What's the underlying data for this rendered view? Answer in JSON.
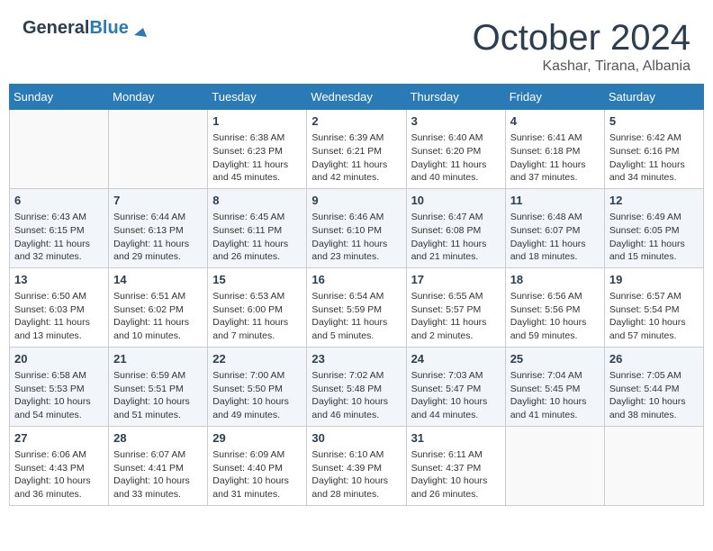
{
  "header": {
    "logo_general": "General",
    "logo_blue": "Blue",
    "month": "October 2024",
    "location": "Kashar, Tirana, Albania"
  },
  "weekdays": [
    "Sunday",
    "Monday",
    "Tuesday",
    "Wednesday",
    "Thursday",
    "Friday",
    "Saturday"
  ],
  "weeks": [
    [
      {
        "day": null
      },
      {
        "day": null
      },
      {
        "day": "1",
        "sunrise": "Sunrise: 6:38 AM",
        "sunset": "Sunset: 6:23 PM",
        "daylight": "Daylight: 11 hours and 45 minutes."
      },
      {
        "day": "2",
        "sunrise": "Sunrise: 6:39 AM",
        "sunset": "Sunset: 6:21 PM",
        "daylight": "Daylight: 11 hours and 42 minutes."
      },
      {
        "day": "3",
        "sunrise": "Sunrise: 6:40 AM",
        "sunset": "Sunset: 6:20 PM",
        "daylight": "Daylight: 11 hours and 40 minutes."
      },
      {
        "day": "4",
        "sunrise": "Sunrise: 6:41 AM",
        "sunset": "Sunset: 6:18 PM",
        "daylight": "Daylight: 11 hours and 37 minutes."
      },
      {
        "day": "5",
        "sunrise": "Sunrise: 6:42 AM",
        "sunset": "Sunset: 6:16 PM",
        "daylight": "Daylight: 11 hours and 34 minutes."
      }
    ],
    [
      {
        "day": "6",
        "sunrise": "Sunrise: 6:43 AM",
        "sunset": "Sunset: 6:15 PM",
        "daylight": "Daylight: 11 hours and 32 minutes."
      },
      {
        "day": "7",
        "sunrise": "Sunrise: 6:44 AM",
        "sunset": "Sunset: 6:13 PM",
        "daylight": "Daylight: 11 hours and 29 minutes."
      },
      {
        "day": "8",
        "sunrise": "Sunrise: 6:45 AM",
        "sunset": "Sunset: 6:11 PM",
        "daylight": "Daylight: 11 hours and 26 minutes."
      },
      {
        "day": "9",
        "sunrise": "Sunrise: 6:46 AM",
        "sunset": "Sunset: 6:10 PM",
        "daylight": "Daylight: 11 hours and 23 minutes."
      },
      {
        "day": "10",
        "sunrise": "Sunrise: 6:47 AM",
        "sunset": "Sunset: 6:08 PM",
        "daylight": "Daylight: 11 hours and 21 minutes."
      },
      {
        "day": "11",
        "sunrise": "Sunrise: 6:48 AM",
        "sunset": "Sunset: 6:07 PM",
        "daylight": "Daylight: 11 hours and 18 minutes."
      },
      {
        "day": "12",
        "sunrise": "Sunrise: 6:49 AM",
        "sunset": "Sunset: 6:05 PM",
        "daylight": "Daylight: 11 hours and 15 minutes."
      }
    ],
    [
      {
        "day": "13",
        "sunrise": "Sunrise: 6:50 AM",
        "sunset": "Sunset: 6:03 PM",
        "daylight": "Daylight: 11 hours and 13 minutes."
      },
      {
        "day": "14",
        "sunrise": "Sunrise: 6:51 AM",
        "sunset": "Sunset: 6:02 PM",
        "daylight": "Daylight: 11 hours and 10 minutes."
      },
      {
        "day": "15",
        "sunrise": "Sunrise: 6:53 AM",
        "sunset": "Sunset: 6:00 PM",
        "daylight": "Daylight: 11 hours and 7 minutes."
      },
      {
        "day": "16",
        "sunrise": "Sunrise: 6:54 AM",
        "sunset": "Sunset: 5:59 PM",
        "daylight": "Daylight: 11 hours and 5 minutes."
      },
      {
        "day": "17",
        "sunrise": "Sunrise: 6:55 AM",
        "sunset": "Sunset: 5:57 PM",
        "daylight": "Daylight: 11 hours and 2 minutes."
      },
      {
        "day": "18",
        "sunrise": "Sunrise: 6:56 AM",
        "sunset": "Sunset: 5:56 PM",
        "daylight": "Daylight: 10 hours and 59 minutes."
      },
      {
        "day": "19",
        "sunrise": "Sunrise: 6:57 AM",
        "sunset": "Sunset: 5:54 PM",
        "daylight": "Daylight: 10 hours and 57 minutes."
      }
    ],
    [
      {
        "day": "20",
        "sunrise": "Sunrise: 6:58 AM",
        "sunset": "Sunset: 5:53 PM",
        "daylight": "Daylight: 10 hours and 54 minutes."
      },
      {
        "day": "21",
        "sunrise": "Sunrise: 6:59 AM",
        "sunset": "Sunset: 5:51 PM",
        "daylight": "Daylight: 10 hours and 51 minutes."
      },
      {
        "day": "22",
        "sunrise": "Sunrise: 7:00 AM",
        "sunset": "Sunset: 5:50 PM",
        "daylight": "Daylight: 10 hours and 49 minutes."
      },
      {
        "day": "23",
        "sunrise": "Sunrise: 7:02 AM",
        "sunset": "Sunset: 5:48 PM",
        "daylight": "Daylight: 10 hours and 46 minutes."
      },
      {
        "day": "24",
        "sunrise": "Sunrise: 7:03 AM",
        "sunset": "Sunset: 5:47 PM",
        "daylight": "Daylight: 10 hours and 44 minutes."
      },
      {
        "day": "25",
        "sunrise": "Sunrise: 7:04 AM",
        "sunset": "Sunset: 5:45 PM",
        "daylight": "Daylight: 10 hours and 41 minutes."
      },
      {
        "day": "26",
        "sunrise": "Sunrise: 7:05 AM",
        "sunset": "Sunset: 5:44 PM",
        "daylight": "Daylight: 10 hours and 38 minutes."
      }
    ],
    [
      {
        "day": "27",
        "sunrise": "Sunrise: 6:06 AM",
        "sunset": "Sunset: 4:43 PM",
        "daylight": "Daylight: 10 hours and 36 minutes."
      },
      {
        "day": "28",
        "sunrise": "Sunrise: 6:07 AM",
        "sunset": "Sunset: 4:41 PM",
        "daylight": "Daylight: 10 hours and 33 minutes."
      },
      {
        "day": "29",
        "sunrise": "Sunrise: 6:09 AM",
        "sunset": "Sunset: 4:40 PM",
        "daylight": "Daylight: 10 hours and 31 minutes."
      },
      {
        "day": "30",
        "sunrise": "Sunrise: 6:10 AM",
        "sunset": "Sunset: 4:39 PM",
        "daylight": "Daylight: 10 hours and 28 minutes."
      },
      {
        "day": "31",
        "sunrise": "Sunrise: 6:11 AM",
        "sunset": "Sunset: 4:37 PM",
        "daylight": "Daylight: 10 hours and 26 minutes."
      },
      {
        "day": null
      },
      {
        "day": null
      }
    ]
  ]
}
